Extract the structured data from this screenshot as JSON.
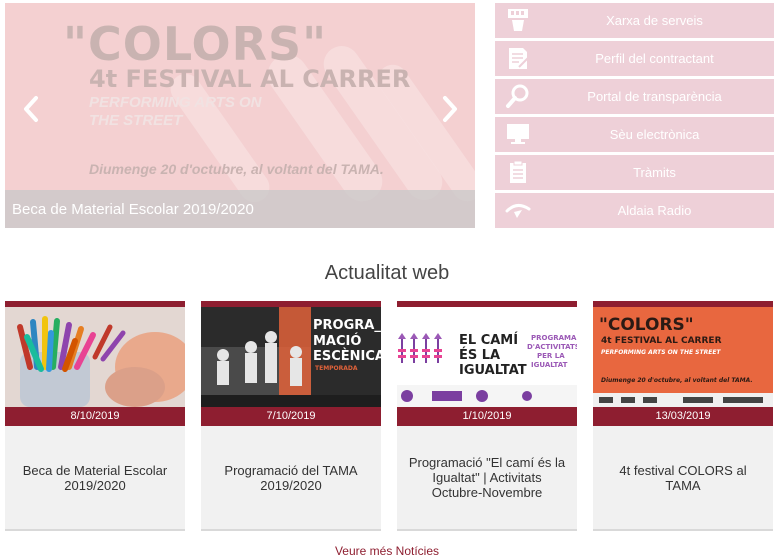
{
  "slider": {
    "caption": "Beca de Material Escolar 2019/2020",
    "slide_texts": {
      "headline": "\"COLORS\"",
      "subheadline": "4t FESTIVAL AL CARRER",
      "tagline": "PERFORMING ARTS ON THE STREET",
      "date_line": "Diumenge 20 d'octubre, al voltant del TAMA."
    },
    "prev_icon": "chevron-left-icon",
    "next_icon": "chevron-right-icon"
  },
  "services": [
    {
      "label": "Xarxa de serveis",
      "icon": "network-icon"
    },
    {
      "label": "Perfil del contractant",
      "icon": "document-sign-icon"
    },
    {
      "label": "Portal de transparència",
      "icon": "magnifier-icon"
    },
    {
      "label": "Sèu electrònica",
      "icon": "monitor-icon"
    },
    {
      "label": "Tràmits",
      "icon": "clipboard-icon"
    },
    {
      "label": "Aldaia Radio",
      "icon": "radio-icon"
    }
  ],
  "news": {
    "title": "Actualitat web",
    "cards": [
      {
        "date": "8/10/2019",
        "title": "Beca de Material Escolar 2019/2020"
      },
      {
        "date": "7/10/2019",
        "title": "Programació del TAMA 2019/2020",
        "thumb_text": {
          "line1": "PROGRA_",
          "line2": "MACIÓ",
          "line3": "ESCÈNICA",
          "line4": "TEMPORADA"
        }
      },
      {
        "date": "1/10/2019",
        "title": "Programació \"El camí és la Igualtat\" | Activitats Octubre-Novembre",
        "thumb_text": {
          "line1": "EL CAMÍ",
          "line2": "ÉS LA",
          "line3": "IGUALTAT",
          "side1": "PROGRAMA",
          "side2": "D'ACTIVITATS",
          "side3": "PER LA",
          "side4": "IGUALTAT"
        }
      },
      {
        "date": "13/03/2019",
        "title": "4t festival COLORS al TAMA",
        "thumb_text": {
          "line1": "\"COLORS\"",
          "line2": "4t FESTIVAL AL CARRER",
          "line3": "PERFORMING ARTS ON THE STREET",
          "line4": "Diumenge 20 d'octubre, al voltant del TAMA."
        }
      }
    ],
    "more_label": "Veure més Notícies"
  },
  "colors": {
    "accent": "#8e1e30",
    "service_bg": "#eed0d8"
  }
}
